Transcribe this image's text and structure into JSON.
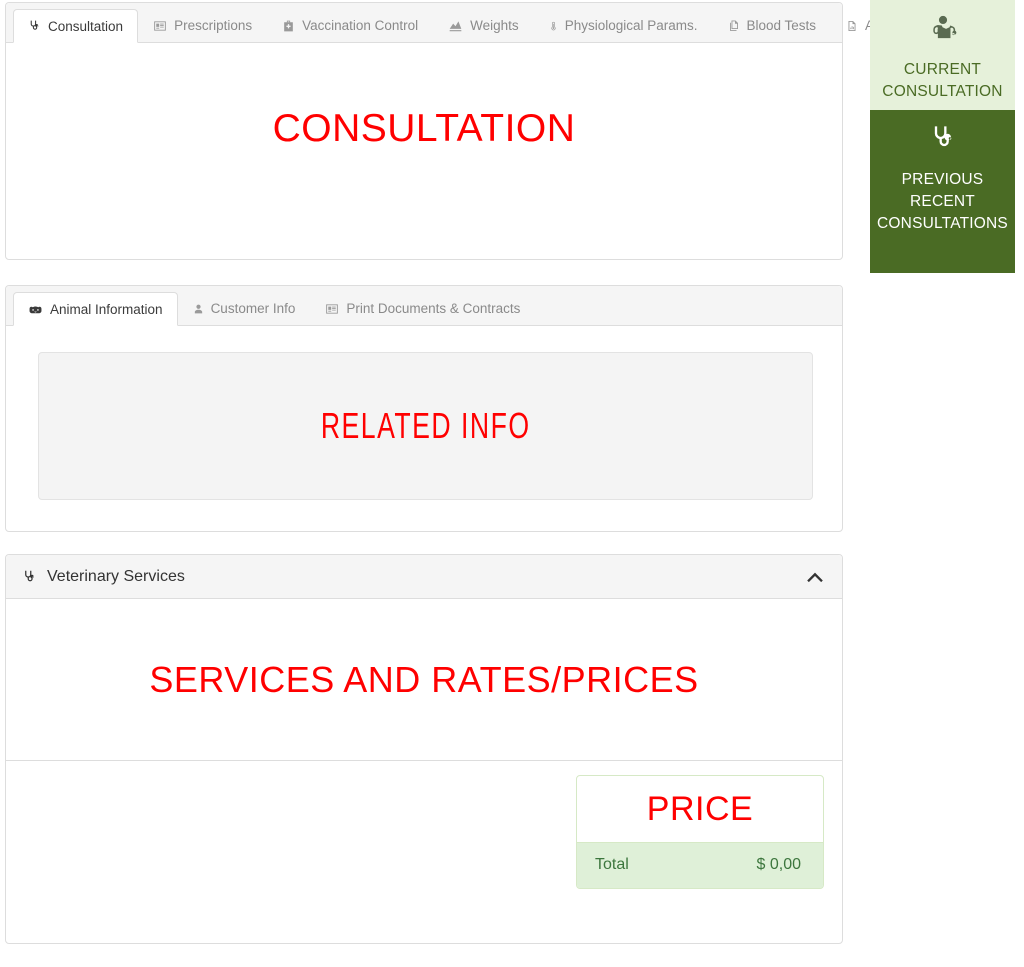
{
  "main_tabs": {
    "items": [
      {
        "label": "Consultation",
        "icon": "stethoscope-icon",
        "active": true
      },
      {
        "label": "Prescriptions",
        "icon": "id-card-icon",
        "active": false
      },
      {
        "label": "Vaccination Control",
        "icon": "first-aid-kit-icon",
        "active": false
      },
      {
        "label": "Weights",
        "icon": "area-chart-icon",
        "active": false
      },
      {
        "label": "Physiological Params.",
        "icon": "thermometer-icon",
        "active": false
      },
      {
        "label": "Blood Tests",
        "icon": "files-icon",
        "active": false
      },
      {
        "label": "Attachments",
        "icon": "file-chart-icon",
        "active": false
      }
    ]
  },
  "consultation_panel": {
    "placeholder": "CONSULTATION"
  },
  "info_tabs": {
    "items": [
      {
        "label": "Animal Information",
        "icon": "hippo-icon",
        "active": true
      },
      {
        "label": "Customer Info",
        "icon": "user-icon",
        "active": false
      },
      {
        "label": "Print Documents & Contracts",
        "icon": "id-card-icon",
        "active": false
      }
    ],
    "placeholder": "RELATED  INFO"
  },
  "services_panel": {
    "title": "Veterinary Services",
    "title_icon": "stethoscope-icon",
    "collapse_icon": "chevron-up-icon",
    "placeholder": "SERVICES AND RATES/PRICES",
    "price_card": {
      "header": "PRICE",
      "total_label": "Total",
      "total_value": "$ 0,00"
    }
  },
  "sidebar": {
    "items": [
      {
        "label": "CURRENT CONSULTATION",
        "icon": "user-doctor-icon",
        "state": "active",
        "bg": "#e6f1da",
        "fg": "#4a6b24"
      },
      {
        "label": "PREVIOUS RECENT CONSULTATIONS",
        "icon": "stethoscope-icon",
        "state": "default",
        "bg": "#4a6b24",
        "fg": "#ffffff"
      }
    ]
  },
  "colors": {
    "placeholder_red": "#ff0000",
    "brand_green_dark": "#4a6b24",
    "brand_green_light": "#e6f1da",
    "success_bg": "#dff0d8",
    "success_text": "#3c763d",
    "panel_border": "#dddddd",
    "tabstrip_bg": "#f5f5f5"
  }
}
